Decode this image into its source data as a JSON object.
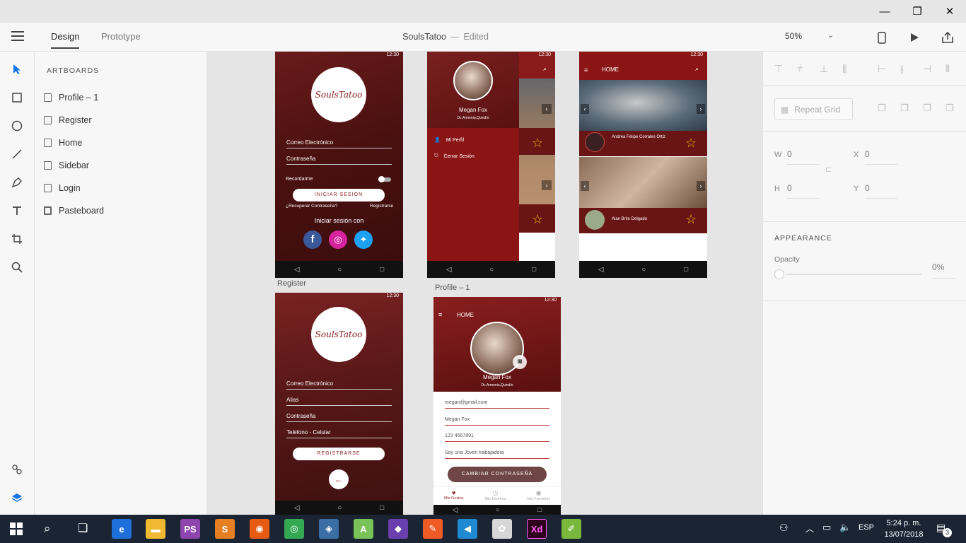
{
  "window": {
    "minimize": "—",
    "restore": "❐",
    "close": "✕"
  },
  "header": {
    "tabs": [
      {
        "label": "Design"
      },
      {
        "label": "Prototype"
      }
    ],
    "doc_title": "SoulsTatoo",
    "doc_sep": "—",
    "doc_status": "Edited",
    "zoom": "50%"
  },
  "tools": [
    "select-tool",
    "rectangle-tool",
    "ellipse-tool",
    "line-tool",
    "pen-tool",
    "text-tool",
    "artboard-tool",
    "zoom-tool",
    "plugins-icon",
    "layers-icon"
  ],
  "layers": {
    "header": "ARTBOARDS",
    "items": [
      {
        "label": "Profile – 1"
      },
      {
        "label": "Register"
      },
      {
        "label": "Home"
      },
      {
        "label": "Sidebar"
      },
      {
        "label": "Login"
      },
      {
        "label": "Pasteboard"
      }
    ]
  },
  "props": {
    "repeat_grid": "Repeat Grid",
    "w_label": "W",
    "w_value": "0",
    "h_label": "H",
    "h_value": "0",
    "x_label": "X",
    "x_value": "0",
    "y_label": "Y",
    "y_value": "0",
    "appearance": "APPEARANCE",
    "opacity_label": "Opacity",
    "opacity_value": "0%"
  },
  "canvas": {
    "status_time": "12:30",
    "login": {
      "logo": "SoulsTatoo",
      "logo_a": "Souls",
      "logo_b": "Tatoo",
      "email": "Correo Electrónico",
      "password": "Contraseña",
      "remember": "Recordarme",
      "login_btn": "INICIAR SESIÓN",
      "forgot": "¿Recuperar Contraseña?",
      "register_link": "Registrarse",
      "login_with": "Iniciar sesión con"
    },
    "sidebar": {
      "name": "Megan Fox",
      "location": "Dc.Armenia,Quindío",
      "menu": [
        {
          "label": "Mi Perfil"
        },
        {
          "label": "Cerrar Sesión"
        }
      ]
    },
    "home": {
      "title": "HOME",
      "cards": [
        {
          "name": "Andrea Felipe Corrales Ortiz"
        },
        {
          "name": "Alan Brito Delgado"
        }
      ]
    },
    "register": {
      "label": "Register",
      "email": "Correo Electrónico",
      "alias": "Alias",
      "password": "Contraseña",
      "phone": "Telefono - Celular",
      "btn": "REGISTRARSE"
    },
    "profile": {
      "label": "Profile – 1",
      "title": "HOME",
      "name": "Megan Fox",
      "location": "Dc.Armenia,Quindío",
      "email": "megan@gmail.com",
      "fullname": "Megan Fox",
      "phone": "123 4567891",
      "bio": "Soy una Joven trabajadora",
      "change_pwd": "CAMBIAR CONTRASEÑA",
      "tabs": [
        {
          "label": "Mis Gustos"
        },
        {
          "label": "Mis Diseños"
        },
        {
          "label": "Mis Favoritos"
        }
      ]
    }
  },
  "taskbar": {
    "apps": [
      {
        "name": "edge",
        "color": "#1e6fd9",
        "glyph": "e"
      },
      {
        "name": "file-explorer",
        "color": "#f1b931",
        "glyph": "▬"
      },
      {
        "name": "phpstorm",
        "color": "#8e44ad",
        "glyph": "PS"
      },
      {
        "name": "sublime",
        "color": "#e67e22",
        "glyph": "S"
      },
      {
        "name": "firefox",
        "color": "#e55b13",
        "glyph": "◉"
      },
      {
        "name": "chrome",
        "color": "#34a853",
        "glyph": "◎"
      },
      {
        "name": "mysql-workbench",
        "color": "#3a6ea5",
        "glyph": "◈"
      },
      {
        "name": "android-studio",
        "color": "#78c257",
        "glyph": "A"
      },
      {
        "name": "visual-studio",
        "color": "#6a3fae",
        "glyph": "◆"
      },
      {
        "name": "postman",
        "color": "#ef5b25",
        "glyph": "✎"
      },
      {
        "name": "vscode",
        "color": "#1f8ad2",
        "glyph": "◀"
      },
      {
        "name": "paint",
        "color": "#d6d6d6",
        "glyph": "✿"
      },
      {
        "name": "adobe-xd",
        "color": "#2e001e",
        "glyph": "Xd"
      },
      {
        "name": "notepad-plus",
        "color": "#79b83c",
        "glyph": "✐"
      }
    ],
    "lang": "ESP",
    "time": "5:24 p. m.",
    "date": "13/07/2018",
    "notif_count": "3"
  }
}
